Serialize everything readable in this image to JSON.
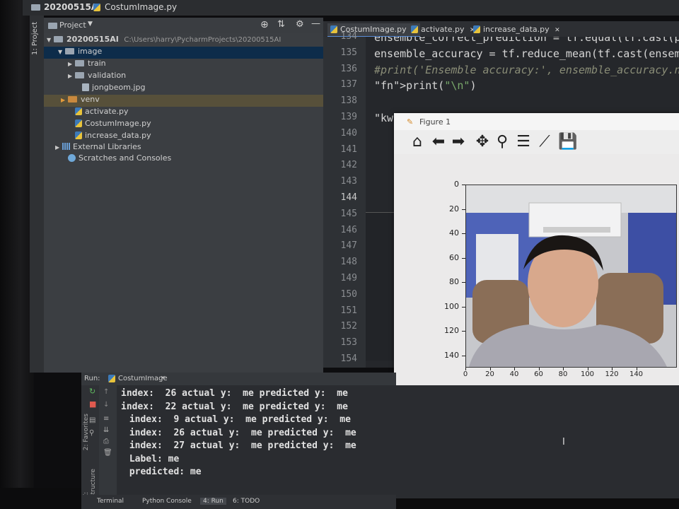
{
  "titlebar": {
    "project": "20200515AI",
    "file": "CostumImage.py"
  },
  "project_toolbar": {
    "label": "Project",
    "strip_label": "1: Project"
  },
  "tree": [
    {
      "label": "20200515AI",
      "path": "C:\\Users\\harry\\PycharmProjects\\20200515AI",
      "kind": "folder"
    },
    {
      "label": "image",
      "kind": "folder",
      "selected": true
    },
    {
      "label": "train",
      "kind": "folder"
    },
    {
      "label": "validation",
      "kind": "folder"
    },
    {
      "label": "jongbeom.jpg",
      "kind": "image"
    },
    {
      "label": "venv",
      "kind": "folder-orange"
    },
    {
      "label": "activate.py",
      "kind": "py"
    },
    {
      "label": "CostumImage.py",
      "kind": "py"
    },
    {
      "label": "increase_data.py",
      "kind": "py"
    },
    {
      "label": "External Libraries",
      "kind": "lib"
    },
    {
      "label": "Scratches and Consoles",
      "kind": "scratch"
    }
  ],
  "editor": {
    "tabs": [
      "CostumImage.py",
      "activate.py",
      "increase_data.py"
    ],
    "line_numbers": [
      "134",
      "135",
      "136",
      "137",
      "138",
      "139",
      "140",
      "141",
      "142",
      "143",
      "144",
      "145",
      "146",
      "147",
      "148",
      "149",
      "150",
      "151",
      "152",
      "153",
      "154"
    ],
    "code_lines": [
      "ensemble_correct_prediction = tf.equal(tf.cast(pr",
      "ensemble_accuracy = tf.reduce_mean(tf.cast(ensemb",
      "#print('Ensemble accuracy:', ensemble_accuracy.num",
      "print(\"\\n\")",
      "",
      "for x",
      "    r",
      "    p",
      "",
      "",
      "",
      "r = r",
      "print",
      "print",
      "plt.i",
      "plt.s",
      "",
      "evalu",
      "print",
      "print",
      ""
    ]
  },
  "figure": {
    "title": "Figure 1",
    "tools": [
      "home-icon",
      "back-icon",
      "forward-icon",
      "pan-icon",
      "zoom-icon",
      "subplots-icon",
      "lines-icon",
      "save-icon"
    ],
    "y_ticks": [
      "0",
      "20",
      "40",
      "60",
      "80",
      "100",
      "120",
      "140"
    ],
    "x_ticks": [
      "0",
      "20",
      "40",
      "60",
      "80",
      "100",
      "120",
      "140"
    ]
  },
  "run": {
    "label": "Run:",
    "config": "CostumImage",
    "lines": [
      "index:  26 actual y:  me predicted y:  me",
      "index:  22 actual y:  me predicted y:  me",
      " index:  9 actual y:  me predicted y:  me",
      " index:  26 actual y:  me predicted y:  me",
      " index:  27 actual y:  me predicted y:  me",
      " Label: me",
      " predicted: me"
    ],
    "side_labels": [
      "2: Favorites",
      "Z: Structure"
    ]
  },
  "bottom_tabs": [
    "Terminal",
    "Python Console",
    "4: Run",
    "6: TODO"
  ]
}
